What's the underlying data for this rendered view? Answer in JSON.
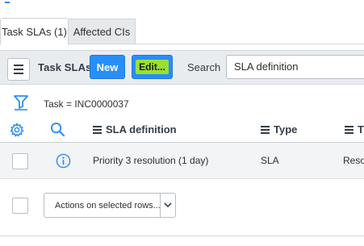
{
  "tabs": [
    {
      "label": "Task SLAs (1)",
      "active": true
    },
    {
      "label": "Affected CIs",
      "active": false
    }
  ],
  "toolbar": {
    "list_title": "Task SLAs",
    "new_label": "New",
    "edit_label": "Edit...",
    "search_label": "Search",
    "search_field": "SLA definition"
  },
  "breadcrumb": "Task = INC0000037",
  "columns": [
    {
      "label": "SLA definition"
    },
    {
      "label": "Type"
    },
    {
      "label": "T"
    }
  ],
  "rows": [
    {
      "sla_definition": "Priority 3 resolution (1 day)",
      "type": "SLA",
      "target": "Reso"
    }
  ],
  "actions": {
    "label": "Actions on selected rows..."
  },
  "colors": {
    "primary": "#278efc",
    "highlight": "#9be02f",
    "toolbar_bg": "#e9ecef",
    "row_bg": "#f3f4f5"
  },
  "icons": [
    "menu-icon",
    "filter-icon",
    "gear-icon",
    "search-icon",
    "info-icon",
    "chevron-down-icon"
  ]
}
